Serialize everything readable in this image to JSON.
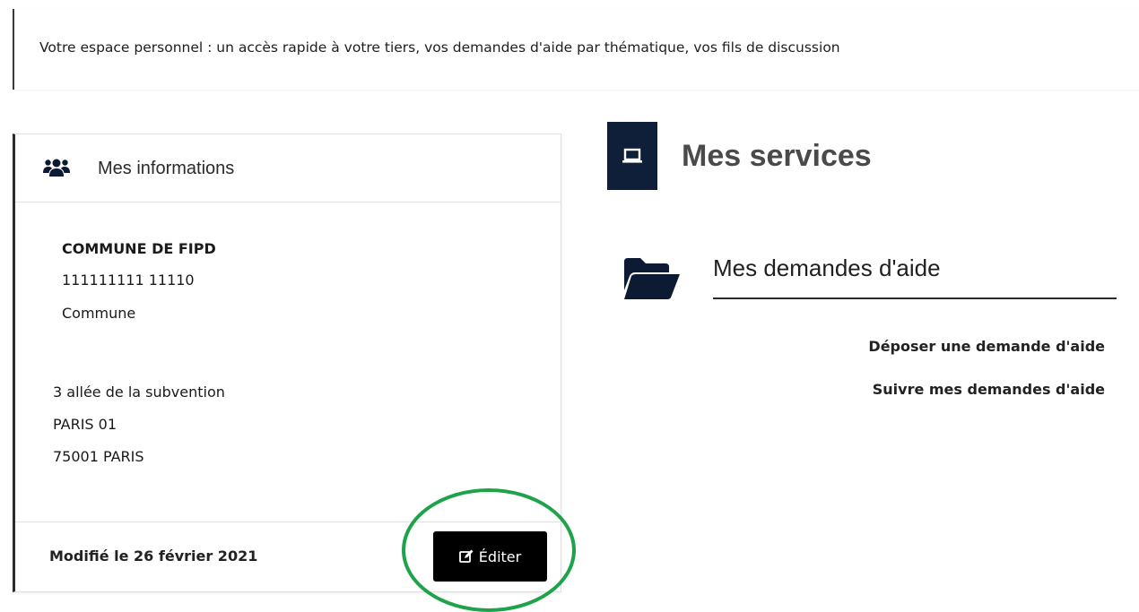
{
  "intro": {
    "text": "Votre espace personnel : un accès rapide à votre tiers, vos demandes d'aide par thématique, vos fils de discussion"
  },
  "info_card": {
    "title": "Mes informations",
    "icon": "users-icon",
    "org_name": "COMMUNE DE FIPD",
    "siret": "111111111 11110",
    "org_type": "Commune",
    "address_line1": "3 allée de la subvention",
    "address_line2": "PARIS 01",
    "address_line3": "75001 PARIS",
    "modified": "Modifié le 26 février 2021",
    "edit_label": "Éditer",
    "edit_icon": "edit-icon"
  },
  "services": {
    "title": "Mes services",
    "icon": "laptop-icon",
    "badge_color": "#0f1f3a",
    "section": {
      "title": "Mes demandes d'aide",
      "icon": "folder-open-icon",
      "links": [
        "Déposer une demande d'aide",
        "Suivre mes demandes d'aide"
      ]
    }
  },
  "annotation": {
    "color": "#1fa34a"
  }
}
